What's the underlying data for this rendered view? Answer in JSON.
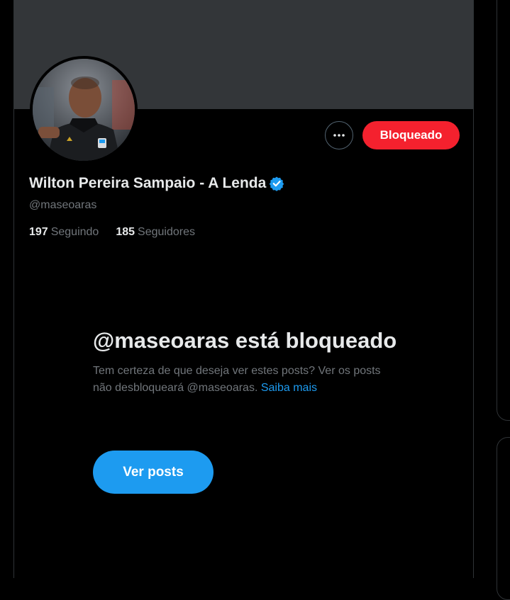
{
  "profile": {
    "display_name": "Wilton Pereira Sampaio - A Lenda",
    "handle": "@maseoaras",
    "following_count": "197",
    "following_label": "Seguindo",
    "followers_count": "185",
    "followers_label": "Seguidores"
  },
  "actions": {
    "more_icon": "more-horizontal-icon",
    "blocked_label": "Bloqueado"
  },
  "blocked_notice": {
    "title": "@maseoaras está bloqueado",
    "description": "Tem certeza de que deseja ver estes posts? Ver os posts não desbloqueará @maseoaras.",
    "learn_more": "Saiba mais",
    "view_posts_label": "Ver posts"
  },
  "colors": {
    "background": "#000000",
    "banner": "#333639",
    "blocked_red": "#f4212e",
    "accent_blue": "#1d9bf0",
    "muted_text": "#71767b",
    "primary_text": "#e7e9ea"
  }
}
